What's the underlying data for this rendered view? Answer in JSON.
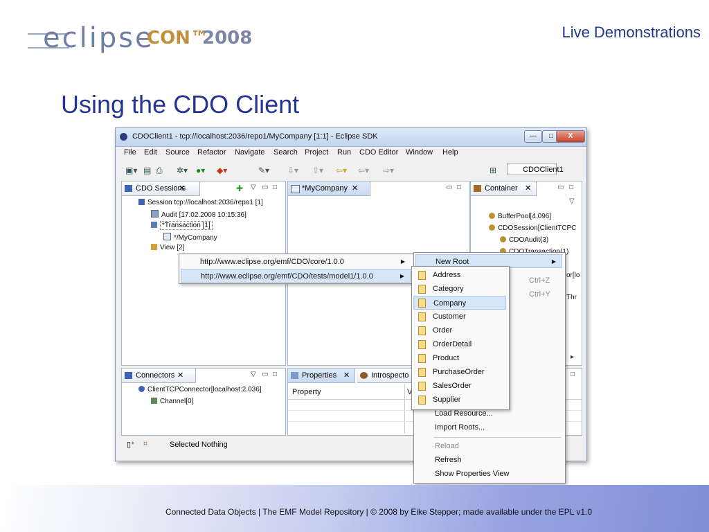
{
  "slide": {
    "logo_eclipse": "eclipse",
    "logo_con": "CON™",
    "logo_year": "2008",
    "header": "Live Demonstrations",
    "title": "Using the CDO Client",
    "footer": "Connected Data Objects  |  The EMF Model Repository  |  © 2008 by Eike Stepper; made available under the EPL v1.0"
  },
  "window": {
    "title": "CDOClient1 - tcp://localhost:2036/repo1/MyCompany [1:1] - Eclipse SDK",
    "min": "—",
    "max": "□",
    "close": "X"
  },
  "menubar": [
    "File",
    "Edit",
    "Source",
    "Refactor",
    "Navigate",
    "Search",
    "Project",
    "Run",
    "CDO Editor",
    "Window",
    "Help"
  ],
  "toolbar": {
    "perspective": "CDOClient1"
  },
  "sessions_view": {
    "tab": "CDO Sessions",
    "items": [
      "Session tcp://localhost:2036/repo1 [1]",
      "Audit [17.02.2008 10:15:36]",
      "*Transaction [1]",
      "*/MyCompany",
      "View [2]"
    ]
  },
  "editor": {
    "tab": "*MyCompany"
  },
  "container_view": {
    "tab": "Container",
    "items": [
      "BufferPool[4.096]",
      "CDOSession[ClientTCPC",
      "CDOAudit(3)",
      "CDOTransaction(1)"
    ],
    "partials": [
      "or[lo",
      "Thr"
    ]
  },
  "connectors_view": {
    "tab": "Connectors",
    "items": [
      "ClientTCPConnector[localhost:2.036]",
      "Channel[0]"
    ]
  },
  "properties_view": {
    "tab": "Properties",
    "tab2": "Introspecto",
    "col1": "Property",
    "col2": "V"
  },
  "status": {
    "text": "Selected Nothing"
  },
  "context_menu": {
    "packages": [
      "http://www.eclipse.org/emf/CDO/core/1.0.0",
      "http://www.eclipse.org/emf/CDO/tests/model1/1.0.0"
    ]
  },
  "popup_menu": {
    "new_root": "New Root",
    "shortcuts": [
      "Ctrl+Z",
      "Ctrl+Y"
    ],
    "items_below": [
      "Load Resource...",
      "Import Roots...",
      "Reload",
      "Refresh",
      "Show Properties View"
    ]
  },
  "class_menu": {
    "items": [
      "Address",
      "Category",
      "Company",
      "Customer",
      "Order",
      "OrderDetail",
      "Product",
      "PurchaseOrder",
      "SalesOrder",
      "Supplier"
    ],
    "selected": "Company"
  },
  "colors": {
    "title": "#25348f",
    "accent": "#1f3a8a"
  }
}
